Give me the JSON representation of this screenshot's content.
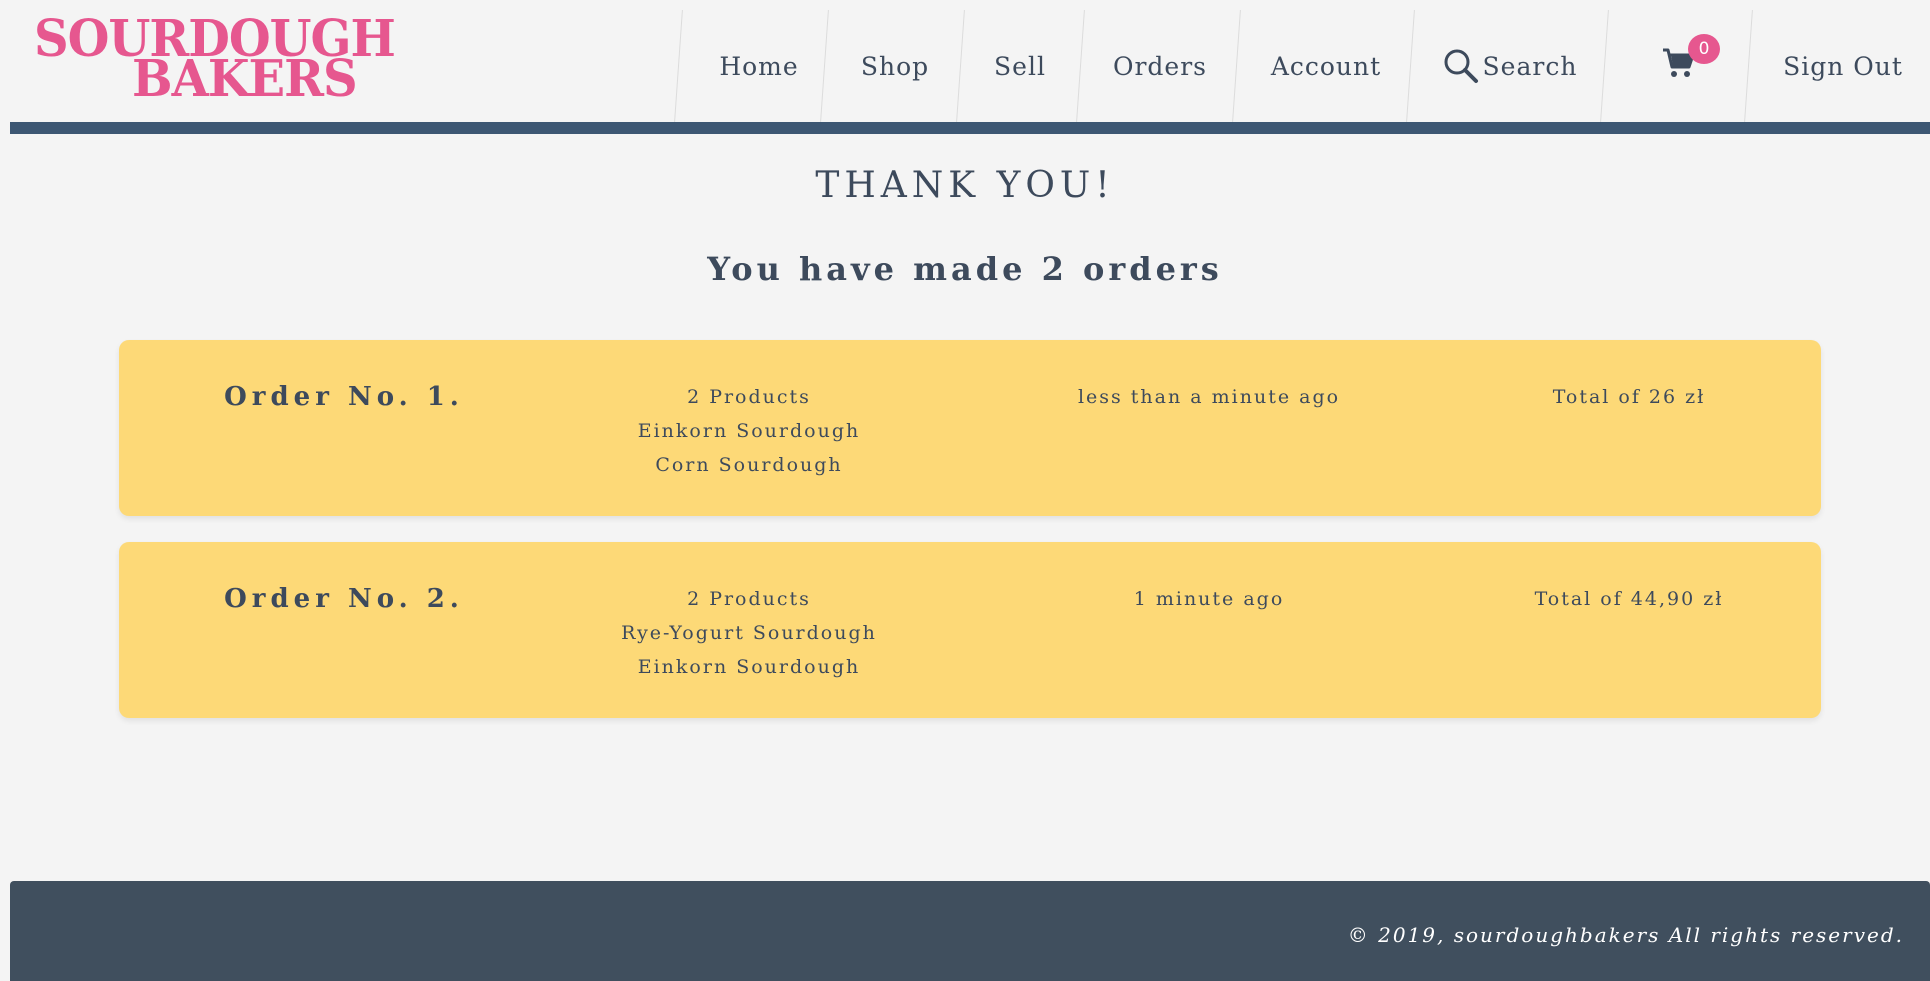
{
  "brand": {
    "line1": "SOURDOUGH",
    "line2": "BAKERS",
    "color": "#e6578f"
  },
  "nav": {
    "home": "Home",
    "shop": "Shop",
    "sell": "Sell",
    "orders": "Orders",
    "account": "Account",
    "search": "Search",
    "cart_count": "0",
    "sign_out": "Sign Out"
  },
  "main": {
    "title": "THANK YOU!",
    "subtitle": "You have made 2 orders",
    "orders": [
      {
        "label": "Order No. 1.",
        "product_count": "2 Products",
        "products": [
          "Einkorn Sourdough",
          "Corn Sourdough"
        ],
        "time": "less than a minute ago",
        "total": "Total of 26 zł"
      },
      {
        "label": "Order No. 2.",
        "product_count": "2 Products",
        "products": [
          "Rye-Yogurt Sourdough",
          "Einkorn Sourdough"
        ],
        "time": "1 minute ago",
        "total": "Total of 44,90 zł"
      }
    ]
  },
  "footer": {
    "copyright": "© 2019, sourdoughbakers All rights reserved."
  },
  "colors": {
    "accent": "#e6578f",
    "navy": "#3d5773",
    "card": "#fdd977",
    "footer": "#404f5e",
    "text": "#3d4a5c"
  },
  "icons": {
    "search": "search-icon",
    "cart": "cart-icon"
  }
}
